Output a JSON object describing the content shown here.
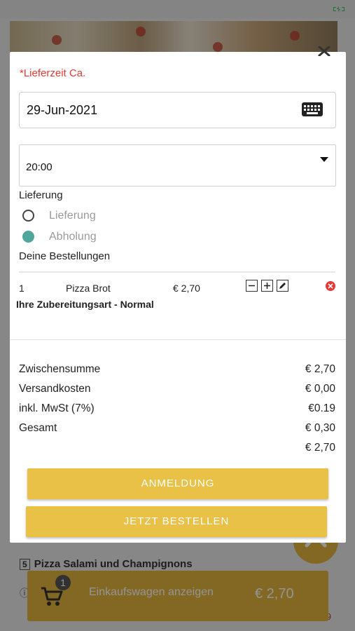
{
  "status_bar": {
    "battery_icon": "battery-charging-icon"
  },
  "background": {
    "item_number": "5",
    "item_name": "Pizza Salami und Champignons",
    "info_icon": "info-icon",
    "cart": {
      "badge_count": "1",
      "label": "Einkaufswagen anzeigen",
      "total": "€ 2,70",
      "icon": "shopping-cart-icon"
    },
    "scroll_top_icon": "chevron-up-icon"
  },
  "modal": {
    "close_icon": "close-icon",
    "delivery_time_label": "*Lieferzeit Ca.",
    "date": {
      "value": "29-Jun-2021",
      "icon": "keyboard-icon"
    },
    "time": {
      "value": "20:00",
      "icon": "dropdown-caret-icon"
    },
    "delivery_type_label": "Lieferung",
    "delivery_options": [
      {
        "label": "Lieferung",
        "selected": false
      },
      {
        "label": "Abholung",
        "selected": true
      }
    ],
    "orders_label": "Deine Bestellungen",
    "orders": [
      {
        "qty": "1",
        "name": "Pizza Brot",
        "price": "€ 2,70",
        "note": "Ihre Zubereitungsart - Normal"
      }
    ],
    "order_controls": {
      "minus_icon": "minus-icon",
      "plus_icon": "plus-icon",
      "edit_icon": "pencil-icon",
      "remove_icon": "remove-icon"
    },
    "summary": [
      {
        "label": "Zwischensumme",
        "value": "€ 2,70"
      },
      {
        "label": "Versandkosten",
        "value": "€ 0,00"
      },
      {
        "label": "inkl. MwSt (7%)",
        "value": "€0.19"
      },
      {
        "label": "Gesamt",
        "value": "€ 0,30"
      },
      {
        "label": "",
        "value": "€ 2,70"
      }
    ],
    "login_button": "ANMELDUNG",
    "order_button": "JETZT BESTELLEN"
  },
  "colors": {
    "accent": "#e9c146",
    "required": "#e53935",
    "radio_selected": "#4fa69a",
    "overlay": "rgba(0,0,0,0.42)"
  }
}
